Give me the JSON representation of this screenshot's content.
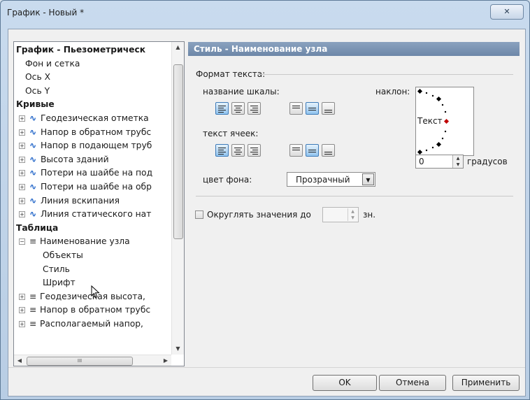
{
  "window": {
    "title": "График - Новый *",
    "close_glyph": "✕"
  },
  "tree": {
    "items": [
      {
        "label": "График - Пьезометрическ",
        "kind": "group"
      },
      {
        "label": "Фон и сетка",
        "kind": "leaf"
      },
      {
        "label": "Ось X",
        "kind": "leaf"
      },
      {
        "label": "Ось Y",
        "kind": "leaf"
      },
      {
        "label": "Кривые",
        "kind": "group"
      },
      {
        "label": "Геодезическая отметка",
        "kind": "curve"
      },
      {
        "label": "Напор в обратном трубс",
        "kind": "curve"
      },
      {
        "label": "Напор в подающем труб",
        "kind": "curve"
      },
      {
        "label": "Высота зданий",
        "kind": "curve"
      },
      {
        "label": "Потери на шайбе на под",
        "kind": "curve"
      },
      {
        "label": "Потери на шайбе на обр",
        "kind": "curve"
      },
      {
        "label": "Линия вскипания",
        "kind": "curve"
      },
      {
        "label": "Линия статического нат",
        "kind": "curve"
      },
      {
        "label": "Таблица",
        "kind": "group"
      },
      {
        "label": "Наименование узла",
        "kind": "table-open"
      },
      {
        "label": "Объекты",
        "kind": "sub"
      },
      {
        "label": "Стиль",
        "kind": "sub"
      },
      {
        "label": "Шрифт",
        "kind": "sub"
      },
      {
        "label": "Геодезическая высота,",
        "kind": "table"
      },
      {
        "label": "Напор в обратном трубс",
        "kind": "table"
      },
      {
        "label": "Располагаемый напор,",
        "kind": "table"
      }
    ],
    "hscroll_grip": "III"
  },
  "panel": {
    "header": "Стиль - Наименование узла",
    "text_format": "Формат текста:",
    "scale_name_label": "название шкалы:",
    "cell_text_label": "текст ячеек:",
    "tilt_label": "наклон:",
    "preview_text": "Текст",
    "bg_color_label": "цвет фона:",
    "bg_color_value": "Прозрачный",
    "angle_value": "0",
    "degrees_label": "градусов",
    "round_label": "Округлять значения до",
    "round_unit": "зн.",
    "round_checked": false
  },
  "buttons": {
    "ok": "OK",
    "cancel": "Отмена",
    "apply": "Применить"
  },
  "colors": {
    "header_bg": "#7a93b3",
    "active_toggle": "#90c3ee",
    "curve_icon": "#1d62c7",
    "pointer_dot": "#c00000"
  }
}
